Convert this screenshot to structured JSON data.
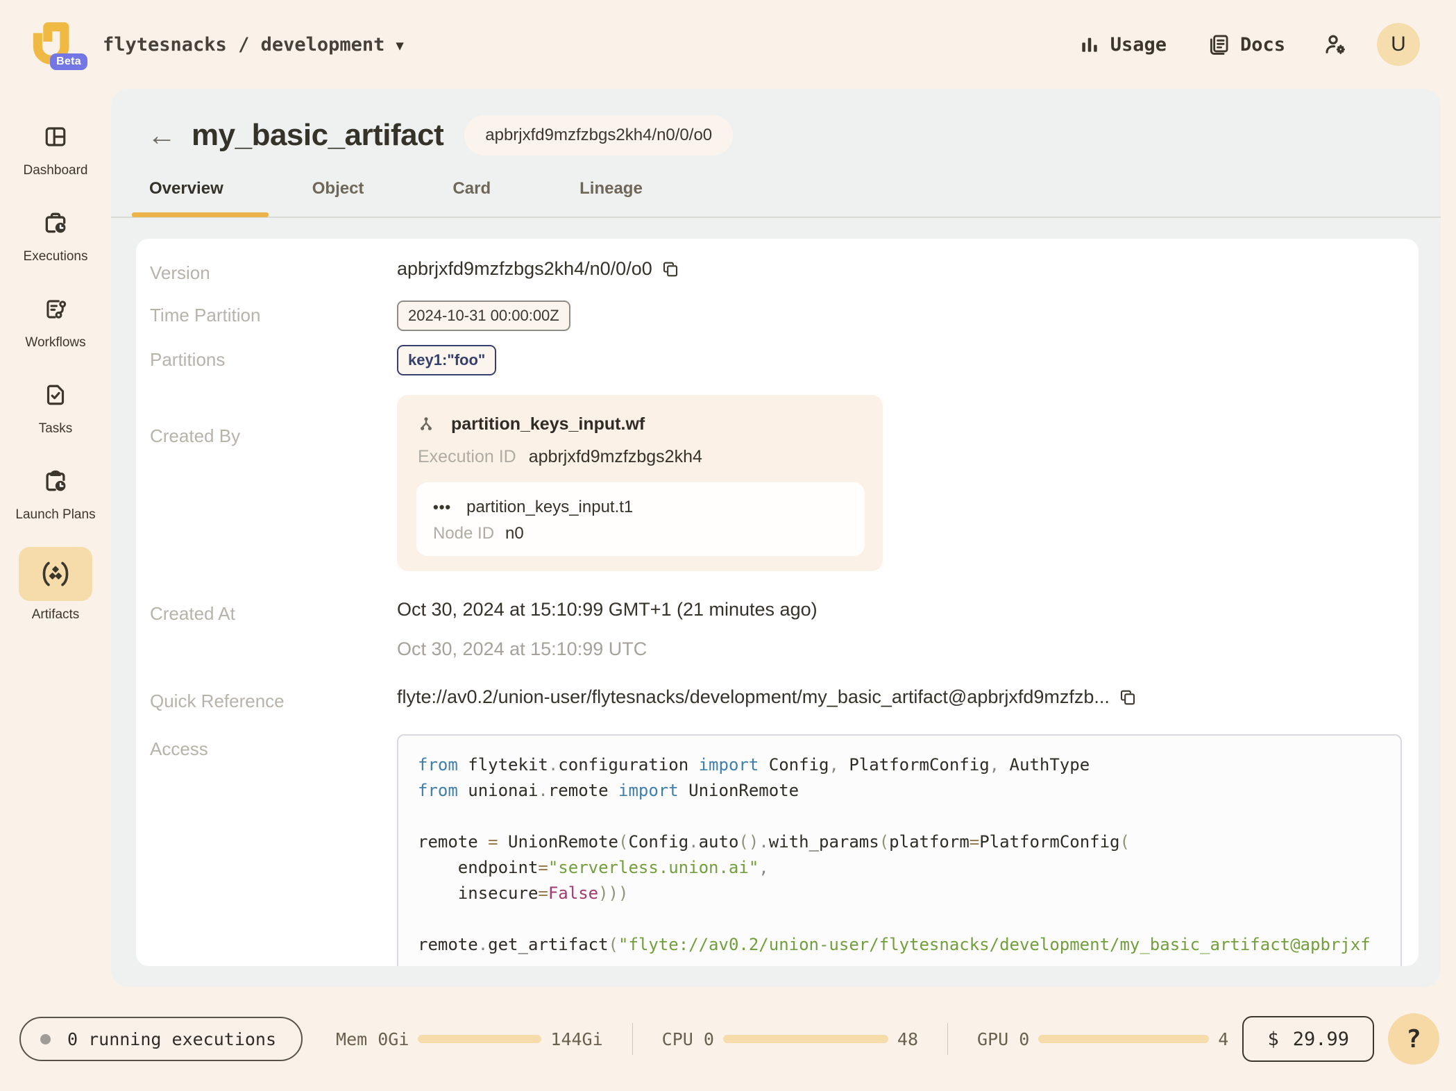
{
  "topbar": {
    "beta": "Beta",
    "breadcrumb": "flytesnacks / development",
    "usage_label": "Usage",
    "docs_label": "Docs",
    "avatar_initial": "U"
  },
  "sidebar": {
    "items": [
      {
        "label": "Dashboard"
      },
      {
        "label": "Executions"
      },
      {
        "label": "Workflows"
      },
      {
        "label": "Tasks"
      },
      {
        "label": "Launch Plans"
      },
      {
        "label": "Artifacts"
      }
    ]
  },
  "header": {
    "back": "←",
    "title": "my_basic_artifact",
    "version_badge": "apbrjxfd9mzfzbgs2kh4/n0/0/o0"
  },
  "tabs": [
    {
      "label": "Overview"
    },
    {
      "label": "Object"
    },
    {
      "label": "Card"
    },
    {
      "label": "Lineage"
    }
  ],
  "overview": {
    "version_label": "Version",
    "version_value": "apbrjxfd9mzfzbgs2kh4/n0/0/o0",
    "time_partition_label": "Time Partition",
    "time_partition_value": "2024-10-31 00:00:00Z",
    "partitions_label": "Partitions",
    "partitions_chip": "key1:\"foo\"",
    "created_by_label": "Created By",
    "created_by": {
      "workflow_name": "partition_keys_input.wf",
      "execution_id_label": "Execution ID",
      "execution_id": "apbrjxfd9mzfzbgs2kh4",
      "task_dots": "•••",
      "task_name": "partition_keys_input.t1",
      "node_id_label": "Node ID",
      "node_id": "n0"
    },
    "created_at_label": "Created At",
    "created_at_local": "Oct 30, 2024 at 15:10:99 GMT+1 (21 minutes ago)",
    "created_at_utc": "Oct 30, 2024 at 15:10:99 UTC",
    "quick_reference_label": "Quick Reference",
    "quick_reference_value": "flyte://av0.2/union-user/flytesnacks/development/my_basic_artifact@apbrjxfd9mzfzb...",
    "access_label": "Access"
  },
  "access_code": {
    "lines": [
      [
        [
          "kw",
          "from"
        ],
        [
          "id",
          " flytekit"
        ],
        [
          "pu",
          "."
        ],
        [
          "id",
          "configuration"
        ],
        [
          "kw",
          " import"
        ],
        [
          "id",
          " Config"
        ],
        [
          "pu",
          ","
        ],
        [
          "id",
          " PlatformConfig"
        ],
        [
          "pu",
          ","
        ],
        [
          "id",
          " AuthType"
        ]
      ],
      [
        [
          "kw",
          "from"
        ],
        [
          "id",
          " unionai"
        ],
        [
          "pu",
          "."
        ],
        [
          "id",
          "remote"
        ],
        [
          "kw",
          " import"
        ],
        [
          "id",
          " UnionRemote"
        ]
      ],
      [],
      [
        [
          "id",
          "remote "
        ],
        [
          "op",
          "="
        ],
        [
          "id",
          " UnionRemote"
        ],
        [
          "par",
          "("
        ],
        [
          "id",
          "Config"
        ],
        [
          "pu",
          "."
        ],
        [
          "id",
          "auto"
        ],
        [
          "par",
          "()"
        ],
        [
          "pu",
          "."
        ],
        [
          "id",
          "with_params"
        ],
        [
          "par",
          "("
        ],
        [
          "id",
          "platform"
        ],
        [
          "op",
          "="
        ],
        [
          "id",
          "PlatformConfig"
        ],
        [
          "par",
          "("
        ]
      ],
      [
        [
          "id",
          "    endpoint"
        ],
        [
          "op",
          "="
        ],
        [
          "str",
          "\"serverless.union.ai\""
        ],
        [
          "pu",
          ","
        ]
      ],
      [
        [
          "id",
          "    insecure"
        ],
        [
          "op",
          "="
        ],
        [
          "bool",
          "False"
        ],
        [
          "par",
          ")))"
        ]
      ],
      [],
      [
        [
          "id",
          "remote"
        ],
        [
          "pu",
          "."
        ],
        [
          "id",
          "get_artifact"
        ],
        [
          "par",
          "("
        ],
        [
          "str",
          "\"flyte://av0.2/union-user/flytesnacks/development/my_basic_artifact@apbrjxf"
        ]
      ]
    ]
  },
  "statusbar": {
    "running_executions": "0 running executions",
    "mem_label": "Mem 0Gi",
    "mem_max": "144Gi",
    "cpu_label": "CPU 0",
    "cpu_max": "48",
    "gpu_label": "GPU 0",
    "gpu_max": "4",
    "cost_currency": "$",
    "cost_value": "29.99",
    "help": "?"
  },
  "colors": {
    "accent_yellow": "#eab44a",
    "highlight_tan": "#f7dcab",
    "beta_purple": "#7277e3",
    "page_cream": "#faf2e9",
    "panel_gray": "#eff1f0",
    "text_dark": "#35322a",
    "label_gray": "#b6b3ab",
    "navy_chip": "#36406e",
    "code_keyword": "#3f7fae",
    "code_string": "#739e3c",
    "code_false": "#a23a6c"
  }
}
